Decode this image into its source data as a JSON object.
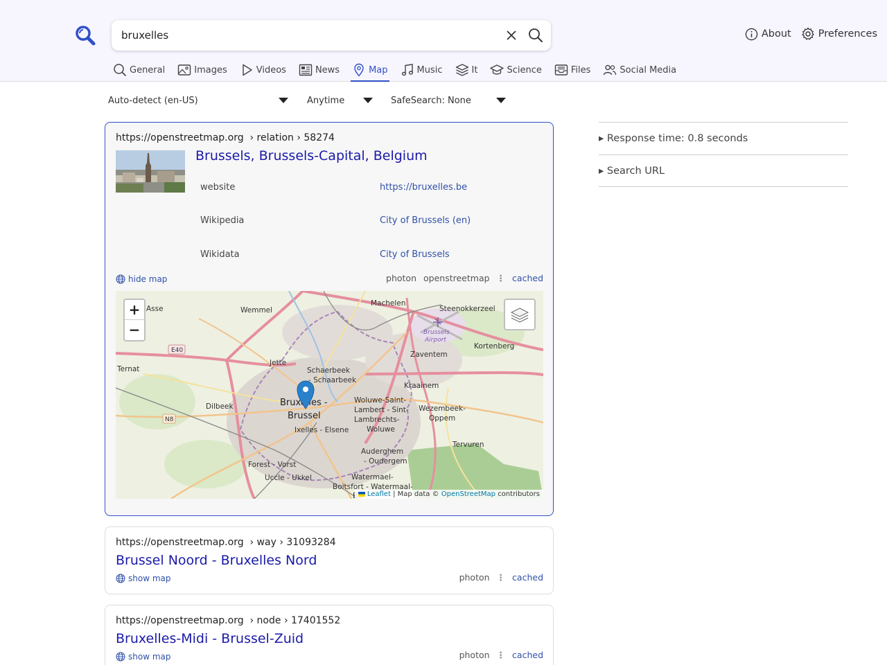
{
  "search": {
    "query": "bruxelles"
  },
  "top_links": [
    {
      "label": "About",
      "icon": "info-icon"
    },
    {
      "label": "Preferences",
      "icon": "gear-icon"
    }
  ],
  "tabs": [
    {
      "label": "General",
      "icon": "search-icon"
    },
    {
      "label": "Images",
      "icon": "image-icon"
    },
    {
      "label": "Videos",
      "icon": "play-icon"
    },
    {
      "label": "News",
      "icon": "newspaper-icon"
    },
    {
      "label": "Map",
      "icon": "map-pin-icon",
      "active": true
    },
    {
      "label": "Music",
      "icon": "music-note-icon"
    },
    {
      "label": "It",
      "icon": "layers-icon"
    },
    {
      "label": "Science",
      "icon": "graduation-cap-icon"
    },
    {
      "label": "Files",
      "icon": "inbox-icon"
    },
    {
      "label": "Social Media",
      "icon": "users-icon"
    }
  ],
  "filters": {
    "language": "Auto-detect (en-US)",
    "time": "Anytime",
    "safesearch": "SafeSearch: None"
  },
  "results": [
    {
      "url": "https://openstreetmap.org",
      "path": "› relation › 58274",
      "title": "Brussels, Brussels-Capital, Belgium",
      "properties": [
        {
          "label": "website",
          "value": "https://bruxelles.be"
        },
        {
          "label": "Wikipedia",
          "value": "City of Brussels (en)"
        },
        {
          "label": "Wikidata",
          "value": "City of Brussels"
        }
      ],
      "map_toggle": "hide map",
      "engines": [
        "photon",
        "openstreetmap"
      ],
      "cached": "cached",
      "map": {
        "zoom_in": "+",
        "zoom_out": "−",
        "attribution_leaflet": "Leaflet",
        "attribution_mid": "| Map data ©",
        "attribution_osm": "OpenStreetMap",
        "attribution_tail": "contributors",
        "places": [
          "Asse",
          "Wemmel",
          "Machelen",
          "Steenokkerzeel",
          "Brussels Airport",
          "Kortenberg",
          "Zaventem",
          "Jette",
          "Schaerbeek - Schaarbeek",
          "Ternat",
          "Kraainem",
          "Dilbeek",
          "Bruxelles - Brussel",
          "Woluwe-Saint-Lambert - Sint-Lambrechts-Woluwe",
          "Wezembeek-Oppem",
          "Ixelles - Elsene",
          "Tervuren",
          "Auderghem - Oudergem",
          "Forest - Vorst",
          "Uccle - Ukkel",
          "Watermael-Boitsfort - Watermaal-Bosvoorde"
        ],
        "road_labels": [
          "E40",
          "N8"
        ]
      }
    },
    {
      "url": "https://openstreetmap.org",
      "path": "› way › 31093284",
      "title": "Brussel Noord - Bruxelles Nord",
      "map_toggle": "show map",
      "engines": [
        "photon"
      ],
      "cached": "cached"
    },
    {
      "url": "https://openstreetmap.org",
      "path": "› node › 17401552",
      "title": "Bruxelles-Midi - Brussel-Zuid",
      "map_toggle": "show map",
      "engines": [
        "photon"
      ],
      "cached": "cached"
    }
  ],
  "sidebar": {
    "response_time": "▸ Response time: 0.8 seconds",
    "search_url": "▸ Search URL"
  },
  "colors": {
    "accent": "#3050c8",
    "link": "#1a1aa8",
    "header_bg": "#f7f5fe"
  }
}
